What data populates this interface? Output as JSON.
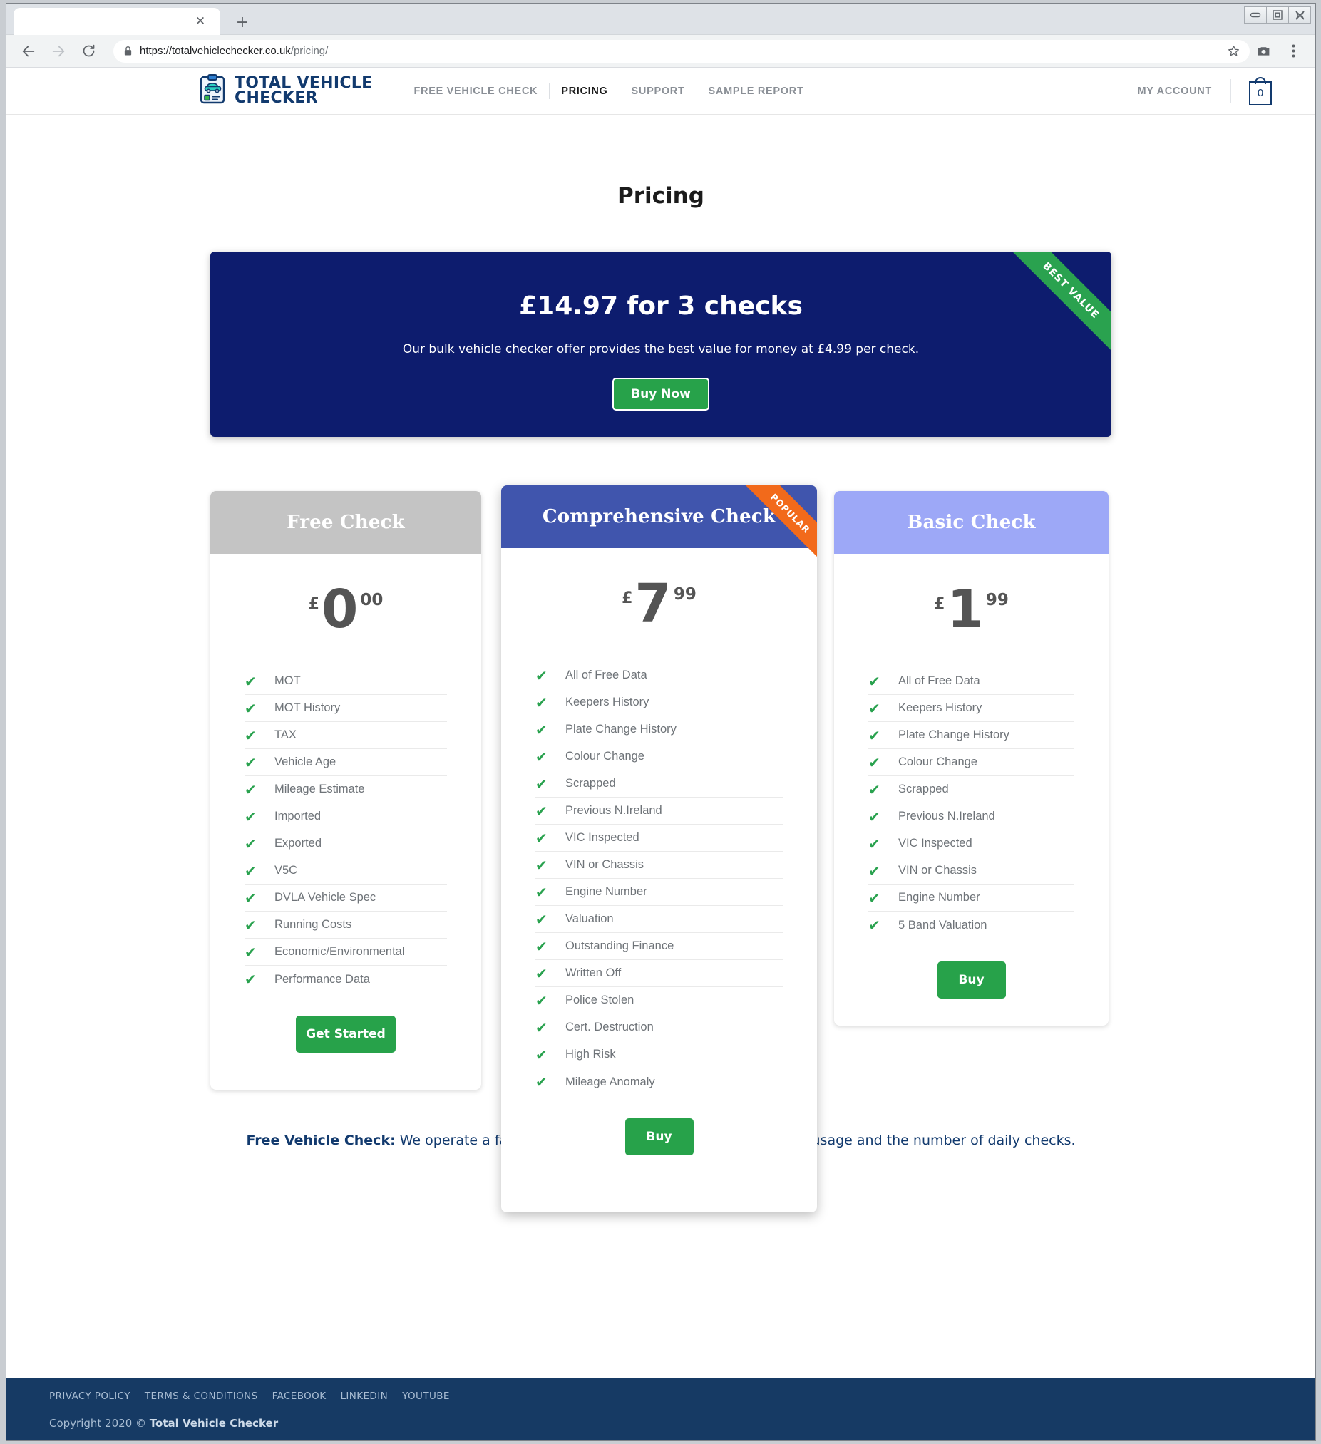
{
  "browser": {
    "tab_title": "",
    "close_icon": "close-icon",
    "newtab_icon": "plus-icon",
    "back_icon": "back-arrow-icon",
    "forward_icon": "forward-arrow-icon",
    "reload_icon": "reload-icon",
    "lock_icon": "lock-icon",
    "url_secure": "https://totalvehiclechecker.co.uk",
    "url_path": "/pricing/",
    "star_icon": "star-icon",
    "camera_icon": "camera-icon",
    "menu_icon": "three-dot-menu-icon",
    "minimize_icon": "minimize-icon",
    "maximize_icon": "maximize-icon",
    "close_window_icon": "close-window-icon"
  },
  "site": {
    "brand_line1": "TOTAL VEHICLE",
    "brand_line2": "CHECKER",
    "logo_icon": "clipboard-car-icon",
    "nav": [
      {
        "label": "FREE VEHICLE CHECK",
        "active": false
      },
      {
        "label": "PRICING",
        "active": true
      },
      {
        "label": "SUPPORT",
        "active": false
      },
      {
        "label": "SAMPLE REPORT",
        "active": false
      }
    ],
    "account_label": "MY ACCOUNT",
    "cart_count": "0",
    "cart_icon": "shopping-bag-icon"
  },
  "page": {
    "title": "Pricing"
  },
  "hero": {
    "ribbon": "BEST VALUE",
    "headline": "£14.97 for 3 checks",
    "subtext": "Our bulk vehicle checker offer provides the best value for money at £4.99 per check.",
    "button": "Buy Now",
    "bg_color": "#0d1c6e",
    "ribbon_color": "#2aa24f"
  },
  "plans": [
    {
      "name": "Free Check",
      "header_color": "#c4c4c4",
      "currency": "£",
      "amount": "0",
      "cents": "00",
      "ribbon": null,
      "features": [
        "MOT",
        "MOT History",
        "TAX",
        "Vehicle Age",
        "Mileage Estimate",
        "Imported",
        "Exported",
        "V5C",
        "DVLA Vehicle Spec",
        "Running Costs",
        "Economic/Environmental",
        "Performance Data"
      ],
      "cta": "Get Started"
    },
    {
      "name": "Comprehensive Check",
      "header_color": "#4055ad",
      "currency": "£",
      "amount": "7",
      "cents": "99",
      "ribbon": "POPULAR",
      "ribbon_color": "#f26a1b",
      "features": [
        "All of Free Data",
        "Keepers History",
        "Plate Change History",
        "Colour Change",
        "Scrapped",
        "Previous N.Ireland",
        "VIC Inspected",
        "VIN or Chassis",
        "Engine Number",
        "Valuation",
        "Outstanding Finance",
        "Written Off",
        "Police Stolen",
        "Cert. Destruction",
        "High Risk",
        "Mileage Anomaly"
      ],
      "cta": "Buy"
    },
    {
      "name": "Basic Check",
      "header_color": "#9da8f7",
      "currency": "£",
      "amount": "1",
      "cents": "99",
      "ribbon": null,
      "features": [
        "All of Free Data",
        "Keepers History",
        "Plate Change History",
        "Colour Change",
        "Scrapped",
        "Previous N.Ireland",
        "VIC Inspected",
        "VIN or Chassis",
        "Engine Number",
        "5 Band Valuation"
      ],
      "cta": "Buy"
    }
  ],
  "note": {
    "bold": "Free Vehicle Check:",
    "rest": " We operate a fair use policy which monitors your free check usage and the number of daily checks."
  },
  "footer": {
    "links": [
      "PRIVACY POLICY",
      "TERMS & CONDITIONS",
      "FACEBOOK",
      "LINKEDIN",
      "YOUTUBE"
    ],
    "copyright_prefix": "Copyright 2020 © ",
    "copyright_brand": "Total Vehicle Checker",
    "bg_color": "#163a64"
  }
}
